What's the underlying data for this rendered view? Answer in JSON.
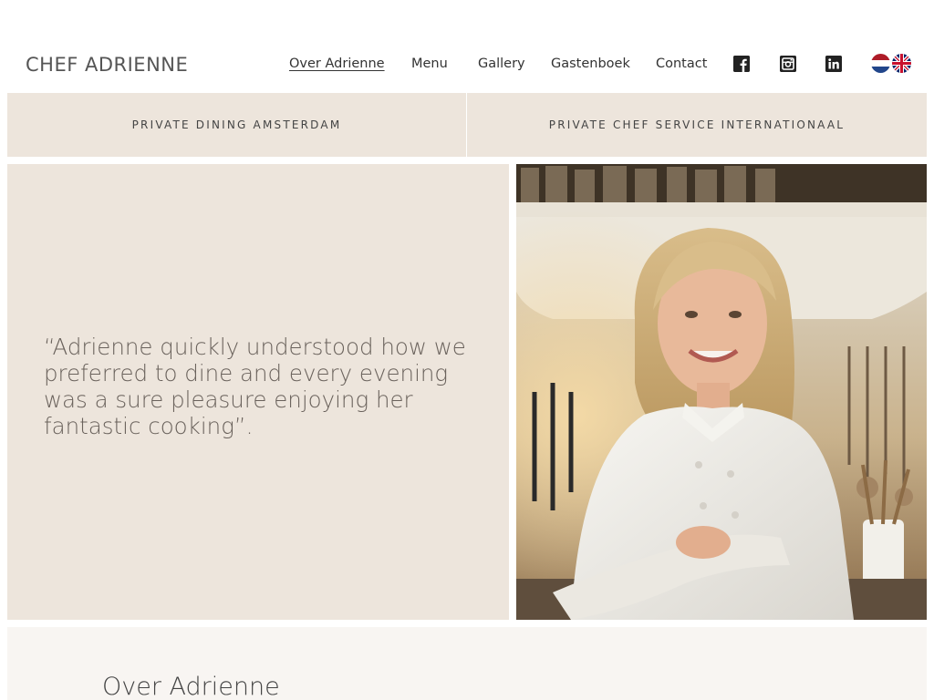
{
  "header": {
    "logo": "CHEF ADRIENNE",
    "nav": [
      {
        "label": "Over Adrienne",
        "active": true
      },
      {
        "label": "Menu",
        "active": false
      },
      {
        "label": "Gallery",
        "active": false
      },
      {
        "label": "Gastenboek",
        "active": false
      },
      {
        "label": "Contact",
        "active": false
      }
    ],
    "social": [
      "facebook-icon",
      "instagram-icon",
      "linkedin-icon"
    ],
    "languages": [
      "nl-flag-icon",
      "uk-flag-icon"
    ]
  },
  "subnav": {
    "left": "PRIVATE DINING AMSTERDAM",
    "right": "PRIVATE CHEF SERVICE INTERNATIONAAL"
  },
  "hero": {
    "quote": "“Adrienne quickly understood how we preferred to dine and every evening was a sure pleasure enjoying her fantastic cooking”."
  },
  "about": {
    "title": "Over Adrienne"
  },
  "colors": {
    "panel": "#ede5dc",
    "about_bg": "#f8f5f2",
    "text": "#333333",
    "quote_text": "#6a625c"
  }
}
